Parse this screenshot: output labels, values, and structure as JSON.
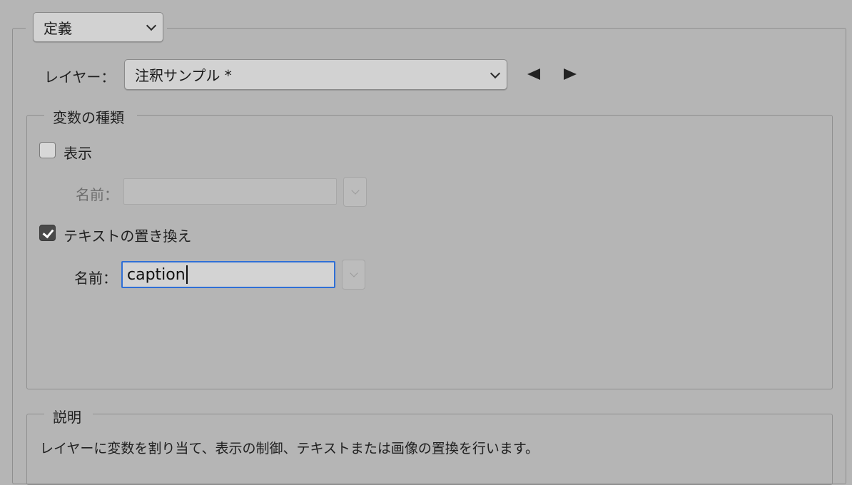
{
  "definition_menu": {
    "selected": "定義"
  },
  "layer": {
    "label": "レイヤー：",
    "selected": "注釈サンプル *",
    "prev_icon": "triangle-left-icon",
    "next_icon": "triangle-right-icon"
  },
  "variable_types": {
    "legend": "変数の種類",
    "visibility": {
      "label": "表示",
      "checked": false,
      "name_label": "名前：",
      "name_value": ""
    },
    "text_replace": {
      "label": "テキストの置き換え",
      "checked": true,
      "name_label": "名前：",
      "name_value": "caption"
    }
  },
  "description": {
    "legend": "説明",
    "text": "レイヤーに変数を割り当て、表示の制御、テキストまたは画像の置換を行います。"
  }
}
